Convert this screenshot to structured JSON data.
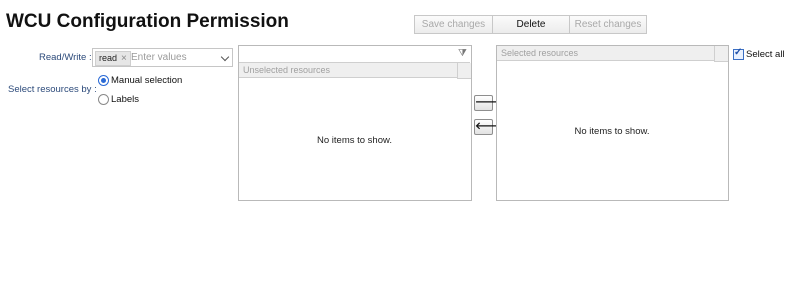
{
  "page": {
    "title": "WCU Configuration Permission"
  },
  "toolbar": {
    "save_label": "Save changes",
    "delete_label": "Delete",
    "reset_label": "Reset changes"
  },
  "form": {
    "readwrite_label": "Read/Write :",
    "readwrite_tags": [
      "read"
    ],
    "readwrite_placeholder": "Enter values",
    "select_by_label": "Select resources by :",
    "options": [
      {
        "label": "Manual selection",
        "checked": true
      },
      {
        "label": "Labels",
        "checked": false
      }
    ]
  },
  "unselected": {
    "header": "Unselected resources",
    "empty_text": "No items to show."
  },
  "selected": {
    "header": "Selected resources",
    "empty_text": "No items to show.",
    "select_all_label": "Select all",
    "select_all_checked": true
  },
  "transfer": {
    "move_right_icon": "arrow-right-icon",
    "move_left_icon": "arrow-left-icon"
  },
  "colors": {
    "label_blue": "#2d4b7b",
    "radio_blue": "#2a6ad6",
    "disabled_text": "#a9a9a9"
  }
}
